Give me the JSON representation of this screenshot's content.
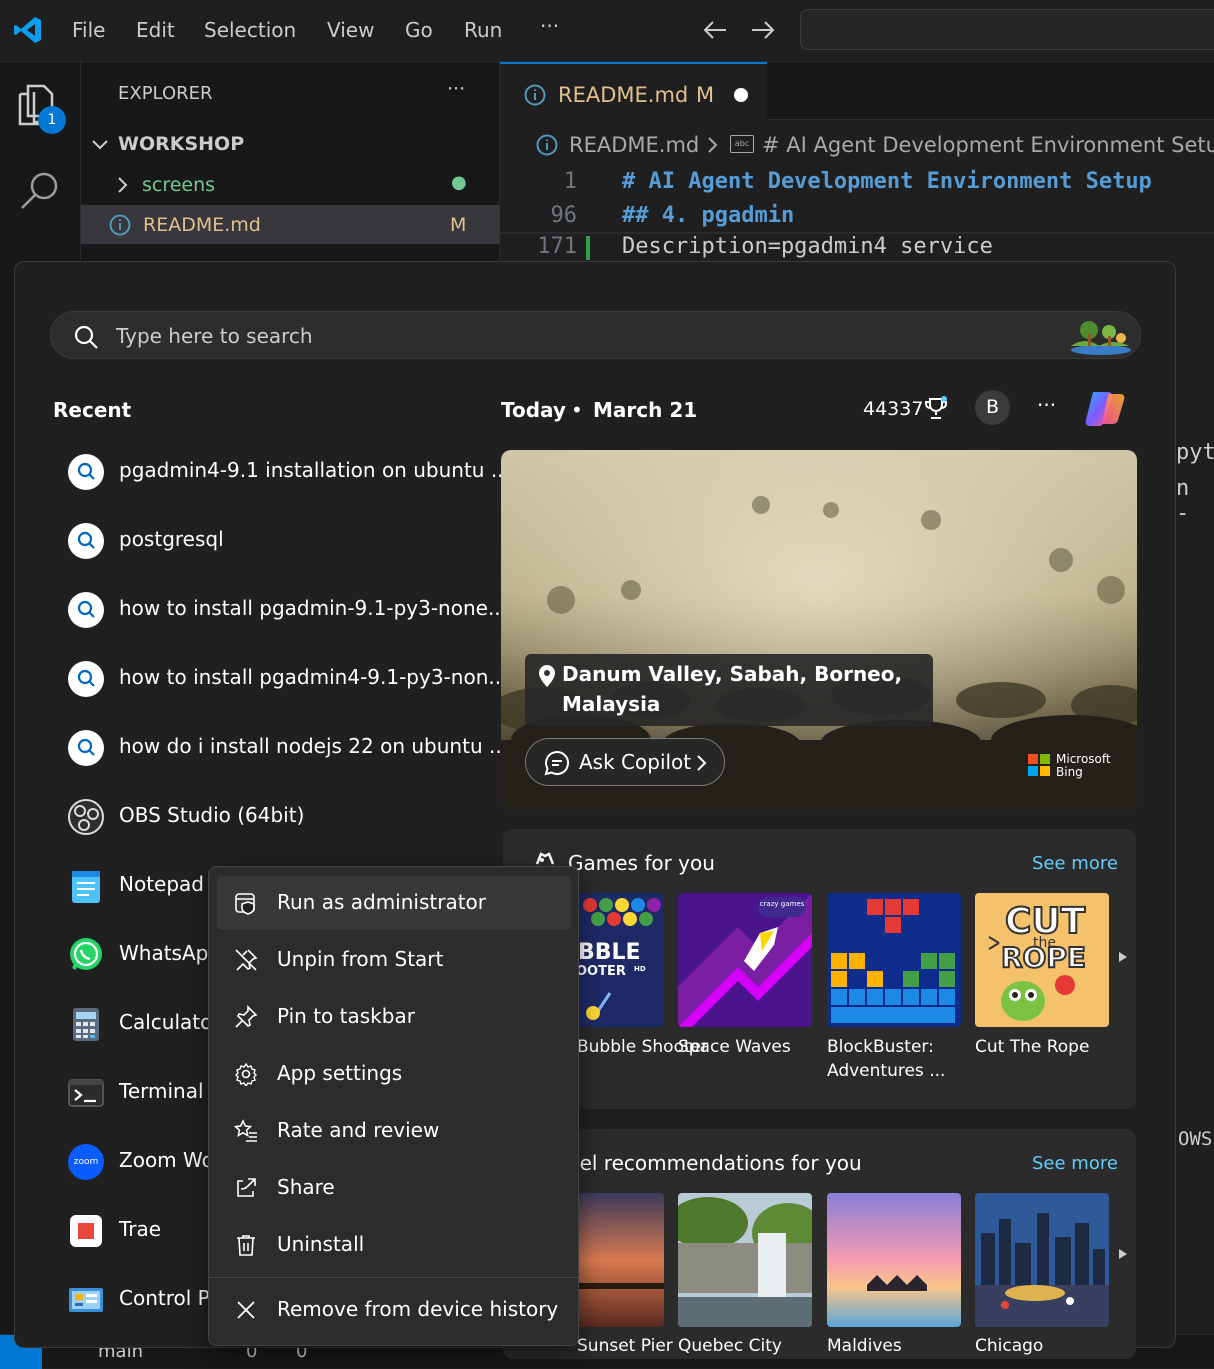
{
  "vscode": {
    "menu": [
      "File",
      "Edit",
      "Selection",
      "View",
      "Go",
      "Run",
      "···"
    ],
    "explorer_title": "EXPLORER",
    "explorer_more": "···",
    "explorer_badge": "1",
    "workspace": "WORKSHOP",
    "tree": [
      {
        "label": "screens",
        "status": "●"
      },
      {
        "label": "README.md",
        "status": "M"
      }
    ],
    "tab": {
      "label": "README.md",
      "status": "M"
    },
    "breadcrumb": {
      "file": "README.md",
      "section": "# AI Agent Development Environment Setup"
    },
    "lines": [
      {
        "num": "1",
        "text": "# AI Agent Development Environment Setup"
      },
      {
        "num": "96",
        "text": "## 4. pgadmin"
      },
      {
        "num": "171",
        "text": "Description=pgadmin4 service"
      }
    ],
    "right_peek": [
      "pyt",
      "n -",
      "OWS"
    ],
    "status": {
      "branch": "main",
      "errors": "0",
      "warnings": "0"
    }
  },
  "start": {
    "search_placeholder": "Type here to search",
    "recent_title": "Recent",
    "recent": [
      {
        "label": "pgadmin4-9.1 installation on ubuntu ...",
        "icon": "search-icon"
      },
      {
        "label": "postgresql",
        "icon": "search-icon"
      },
      {
        "label": "how to install pgadmin-9.1-py3-none...",
        "icon": "search-icon"
      },
      {
        "label": "how to install pgadmin4-9.1-py3-non...",
        "icon": "search-icon"
      },
      {
        "label": "how do i install nodejs 22 on ubuntu ...",
        "icon": "search-icon"
      },
      {
        "label": "OBS Studio (64bit)",
        "icon": "obs-icon"
      },
      {
        "label": "Notepad",
        "icon": "notepad-icon"
      },
      {
        "label": "WhatsApp",
        "icon": "whatsapp-icon"
      },
      {
        "label": "Calculator",
        "icon": "calculator-icon"
      },
      {
        "label": "Terminal",
        "icon": "terminal-icon"
      },
      {
        "label": "Zoom Workplace",
        "icon": "zoom-icon"
      },
      {
        "label": "Trae",
        "icon": "trae-icon"
      },
      {
        "label": "Control Panel",
        "icon": "control-panel-icon"
      }
    ],
    "today": "Today",
    "date": "March 21",
    "points": "44337",
    "avatar": "B",
    "more": "···",
    "hero": {
      "location_line1": "Danum Valley, Sabah, Borneo,",
      "location_line2": "Malaysia",
      "ask_copilot": "Ask Copilot",
      "bing_line1": "Microsoft",
      "bing_line2": "Bing"
    },
    "games": {
      "title": "Games for you",
      "see_more": "See more",
      "items": [
        "Bubble Shooter",
        "Space Waves",
        "BlockBuster: Adventures ...",
        "Cut The Rope"
      ],
      "tile_text": {
        "bubble1": "BBLE",
        "bubble2": "OOTER",
        "bubble3": "HD",
        "crazy": "crazy games",
        "cut1": "CUT",
        "cut2": "the",
        "cut3": "ROPE"
      }
    },
    "travel": {
      "title": "Travel recommendations for you",
      "see_more": "See more",
      "items": [
        "Sunset Pier",
        "Quebec City",
        "Maldives",
        "Chicago"
      ]
    }
  },
  "context_menu": [
    {
      "label": "Run as administrator",
      "icon": "shield-app-icon"
    },
    {
      "label": "Unpin from Start",
      "icon": "unpin-icon"
    },
    {
      "label": "Pin to taskbar",
      "icon": "pin-icon"
    },
    {
      "label": "App settings",
      "icon": "gear-icon"
    },
    {
      "label": "Rate and review",
      "icon": "rate-review-icon"
    },
    {
      "label": "Share",
      "icon": "share-icon"
    },
    {
      "label": "Uninstall",
      "icon": "trash-icon"
    },
    {
      "label": "Remove from device history",
      "icon": "close-icon"
    }
  ],
  "colors": {
    "accent": "#0078d4",
    "link": "#60cdff",
    "modified": "#e2c08d",
    "untracked": "#73c991"
  }
}
